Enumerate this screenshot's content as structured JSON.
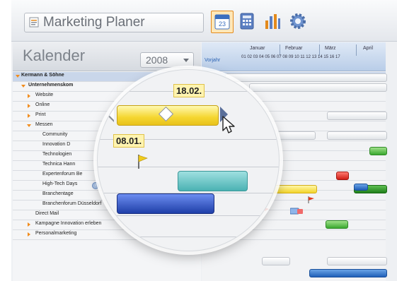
{
  "app": {
    "title": "Marketing Planer"
  },
  "toolbar": {
    "buttons": [
      {
        "icon": "calendar-icon",
        "label": "Kalender"
      },
      {
        "icon": "calculator-icon",
        "label": "Budget"
      },
      {
        "icon": "chart-icon",
        "label": "Reports"
      },
      {
        "icon": "gear-icon",
        "label": "Setup"
      }
    ]
  },
  "calendar": {
    "title": "Kalender",
    "year": "2008",
    "vorjahr": "Vorjahr",
    "months": [
      "Januar",
      "Februar",
      "März",
      "April"
    ],
    "weeks": "01 02 03 04 05 06 07 08 09 10 11 12 13 14 15 16 17"
  },
  "tree": [
    {
      "label": "Kermann & Söhne",
      "level": 0,
      "bold": true,
      "expanded": true,
      "selected": true
    },
    {
      "label": "Unternehmenskom",
      "level": 1,
      "bold": true,
      "expanded": true
    },
    {
      "label": "Website",
      "level": 2,
      "expandable": true
    },
    {
      "label": "Online",
      "level": 2,
      "expandable": true
    },
    {
      "label": "Print",
      "level": 2,
      "expandable": true
    },
    {
      "label": "Messen",
      "level": 2,
      "expanded": true
    },
    {
      "label": "Community",
      "level": 3
    },
    {
      "label": "Innovation D",
      "level": 3
    },
    {
      "label": "Technologien",
      "level": 3
    },
    {
      "label": "Technica Hann",
      "level": 3
    },
    {
      "label": "Expertenforum Be",
      "level": 3
    },
    {
      "label": "High-Tech Days",
      "level": 3,
      "info": true
    },
    {
      "label": "Branchentage",
      "level": 3
    },
    {
      "label": "Branchenforum Düsseldorf",
      "level": 3,
      "info": true,
      "warning": true
    },
    {
      "label": "Direct Mail",
      "level": 2
    },
    {
      "label": "Kampagne Innovation erleben",
      "level": 1,
      "expandable": true
    },
    {
      "label": "Personalmarketing",
      "level": 1,
      "expandable": true
    }
  ],
  "magnifier": {
    "end_date": "18.02.",
    "start_date": "08.01."
  },
  "colors": {
    "accent": "#f28c1c",
    "bar_yellow": "#f3d42a",
    "bar_green": "#3aa830",
    "bar_blue": "#1f5fb8",
    "bar_red": "#d01e16",
    "selection": "#c9d6ea"
  }
}
